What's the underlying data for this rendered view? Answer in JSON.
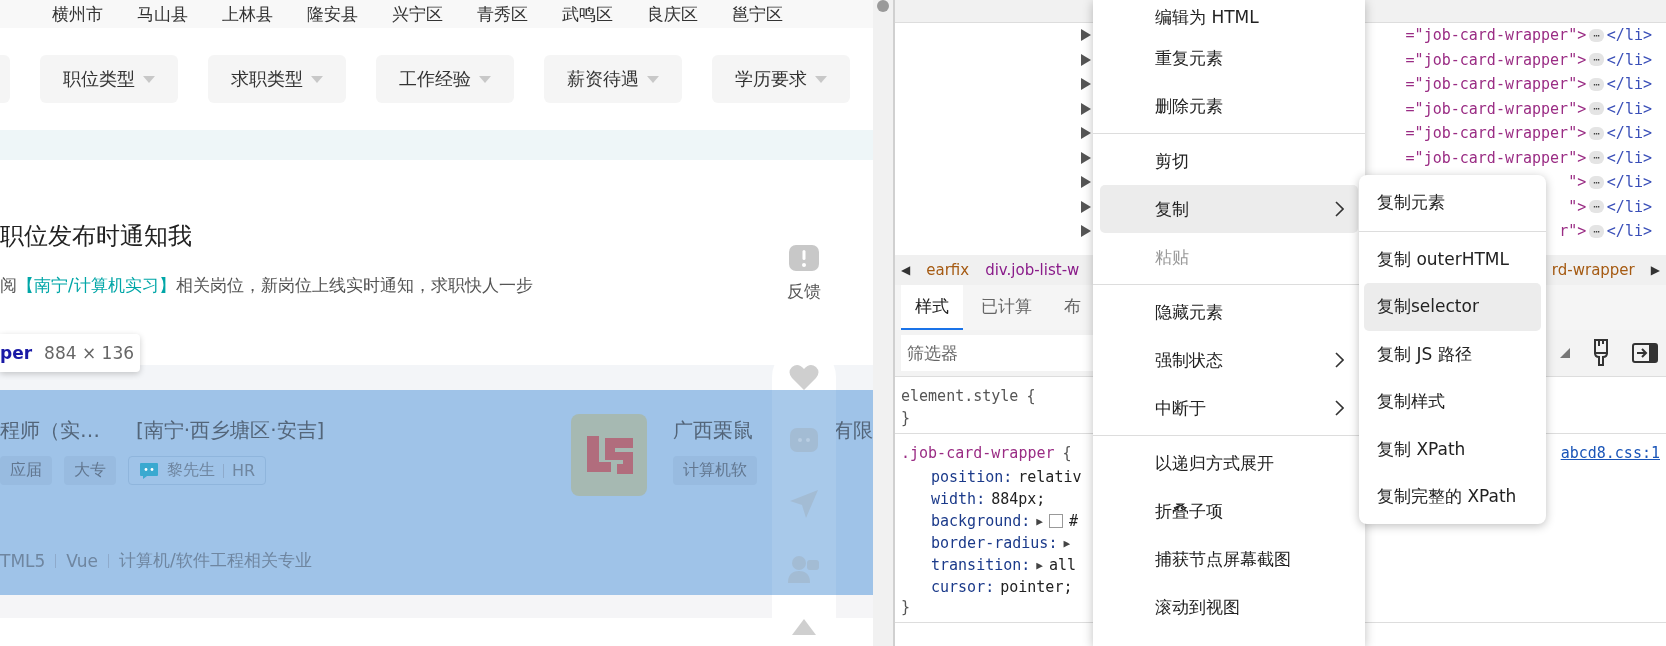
{
  "page": {
    "location_tabs": [
      "横州市",
      "马山县",
      "上林县",
      "隆安县",
      "兴宁区",
      "青秀区",
      "武鸣区",
      "良庆区",
      "邕宁区"
    ],
    "filters": [
      "职位类型",
      "求职类型",
      "工作经验",
      "薪资待遇",
      "学历要求"
    ],
    "subscribe": {
      "title": "职位发布时通知我",
      "text_before": "阅",
      "keyword": "【南宁/计算机实习】",
      "text_after": "相关岗位，新岗位上线实时通知，求职快人一步"
    },
    "inspector_tooltip": {
      "selector": "per",
      "size": "884 × 136"
    },
    "job_card": {
      "highlighted": true,
      "title": "程师（实…",
      "location": "[南宁·西乡塘区·安吉]",
      "tags": [
        "应届",
        "大专"
      ],
      "recruiter": "黎先生",
      "recruiter_role": "HR",
      "company": "广西栗鼠",
      "company_rest": "有限",
      "company_tags": [
        "计算机软"
      ],
      "skills": [
        "TML5",
        "Vue",
        "计算机/软件工程相关专业"
      ]
    },
    "float_bar": {
      "feedback_label": "反馈"
    }
  },
  "devtools": {
    "dom_rows": [
      {
        "attr": "=\"job-card-wrapper\">",
        "ellipsis": "⋯",
        "close_tag": "</li>"
      },
      {
        "attr": "=\"job-card-wrapper\">",
        "ellipsis": "⋯",
        "close_tag": "</li>"
      },
      {
        "attr": "=\"job-card-wrapper\">",
        "ellipsis": "⋯",
        "close_tag": "</li>"
      },
      {
        "attr": "=\"job-card-wrapper\">",
        "ellipsis": "⋯",
        "close_tag": "</li>"
      },
      {
        "attr": "=\"job-card-wrapper\">",
        "ellipsis": "⋯",
        "close_tag": "</li>"
      },
      {
        "attr": "=\"job-card-wrapper\">",
        "ellipsis": "⋯",
        "close_tag": "</li>"
      },
      {
        "attr": "\">",
        "ellipsis": "⋯",
        "close_tag": "</li>"
      },
      {
        "attr": "\">",
        "ellipsis": "⋯",
        "close_tag": "</li>"
      },
      {
        "attr": "r\">",
        "ellipsis": "⋯",
        "close_tag": "</li>"
      }
    ],
    "breadcrumbs": {
      "scroll_left": "◀",
      "items": [
        "earfix",
        "div.job-list-w",
        "rd-wrapper"
      ],
      "scroll_right": "▶"
    },
    "tabs": [
      {
        "label": "样式",
        "selected": true
      },
      {
        "label": "已计算",
        "selected": false
      },
      {
        "label": "布",
        "selected": false
      }
    ],
    "filter_placeholder": "筛选器",
    "rules": [
      {
        "selector": "element.style",
        "open": "{",
        "close": "}"
      },
      {
        "selector": ".job-card-wrapper",
        "open": "{",
        "close": "}",
        "source": "abcd8.css:1",
        "declarations": [
          {
            "name": "position:",
            "value": "relativ"
          },
          {
            "name": "width:",
            "value": "884px;"
          },
          {
            "name": "background:",
            "expander": "▶",
            "color": "#ffffff",
            "value": "#"
          },
          {
            "name": "border-radius:",
            "expander": "▶"
          },
          {
            "name": "transition:",
            "expander": "▶",
            "value": "all"
          },
          {
            "name": "cursor:",
            "value": "pointer;"
          }
        ]
      }
    ]
  },
  "context_menu": {
    "items": [
      {
        "kind": "item",
        "label": "编辑为 HTML",
        "highlighted": false,
        "disabled": false,
        "submenu": false
      },
      {
        "kind": "item",
        "label": "重复元素",
        "highlighted": false,
        "disabled": false,
        "submenu": false
      },
      {
        "kind": "item",
        "label": "删除元素",
        "highlighted": false,
        "disabled": false,
        "submenu": false
      },
      {
        "kind": "separator"
      },
      {
        "kind": "item",
        "label": "剪切",
        "highlighted": false,
        "disabled": false,
        "submenu": false
      },
      {
        "kind": "item",
        "label": "复制",
        "highlighted": true,
        "disabled": false,
        "submenu": true
      },
      {
        "kind": "item",
        "label": "粘贴",
        "highlighted": false,
        "disabled": true,
        "submenu": false
      },
      {
        "kind": "separator"
      },
      {
        "kind": "item",
        "label": "隐藏元素",
        "highlighted": false,
        "disabled": false,
        "submenu": false
      },
      {
        "kind": "item",
        "label": "强制状态",
        "highlighted": false,
        "disabled": false,
        "submenu": true
      },
      {
        "kind": "item",
        "label": "中断于",
        "highlighted": false,
        "disabled": false,
        "submenu": true
      },
      {
        "kind": "separator"
      },
      {
        "kind": "item",
        "label": "以递归方式展开",
        "highlighted": false,
        "disabled": false,
        "submenu": false
      },
      {
        "kind": "item",
        "label": "折叠子项",
        "highlighted": false,
        "disabled": false,
        "submenu": false
      },
      {
        "kind": "item",
        "label": "捕获节点屏幕截图",
        "highlighted": false,
        "disabled": false,
        "submenu": false
      },
      {
        "kind": "item",
        "label": "滚动到视图",
        "highlighted": false,
        "disabled": false,
        "submenu": false
      }
    ]
  },
  "copy_submenu": {
    "items": [
      {
        "kind": "item",
        "label": "复制元素",
        "highlighted": false
      },
      {
        "kind": "separator"
      },
      {
        "kind": "item",
        "label": "复制 outerHTML",
        "highlighted": false
      },
      {
        "kind": "item",
        "label": "复制selector",
        "highlighted": true
      },
      {
        "kind": "item",
        "label": "复制 JS 路径",
        "highlighted": false
      },
      {
        "kind": "item",
        "label": "复制样式",
        "highlighted": false
      },
      {
        "kind": "item",
        "label": "复制 XPath",
        "highlighted": false
      },
      {
        "kind": "item",
        "label": "复制完整的 XPath",
        "highlighted": false
      }
    ]
  }
}
